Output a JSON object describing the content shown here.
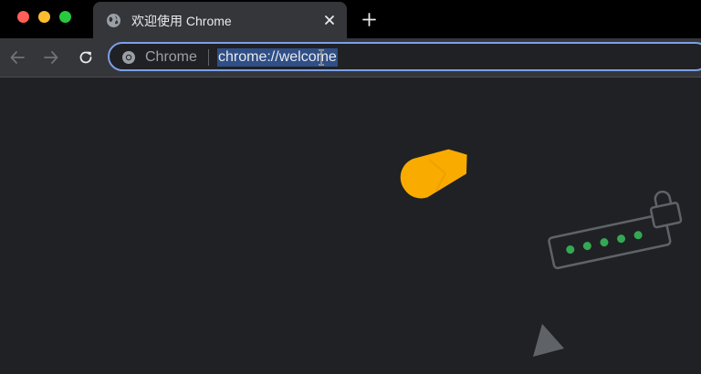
{
  "window": {
    "traffic_lights": [
      "close",
      "minimize",
      "zoom"
    ]
  },
  "tab": {
    "title": "欢迎使用 Chrome",
    "icon": "globe-icon"
  },
  "toolbar": {
    "site_label": "Chrome",
    "url": "chrome://welcome"
  },
  "colors": {
    "background": "#202124",
    "accent_yellow": "#f9ab00",
    "accent_green": "#34a853",
    "omnibox_focus": "#7ca0e6"
  }
}
